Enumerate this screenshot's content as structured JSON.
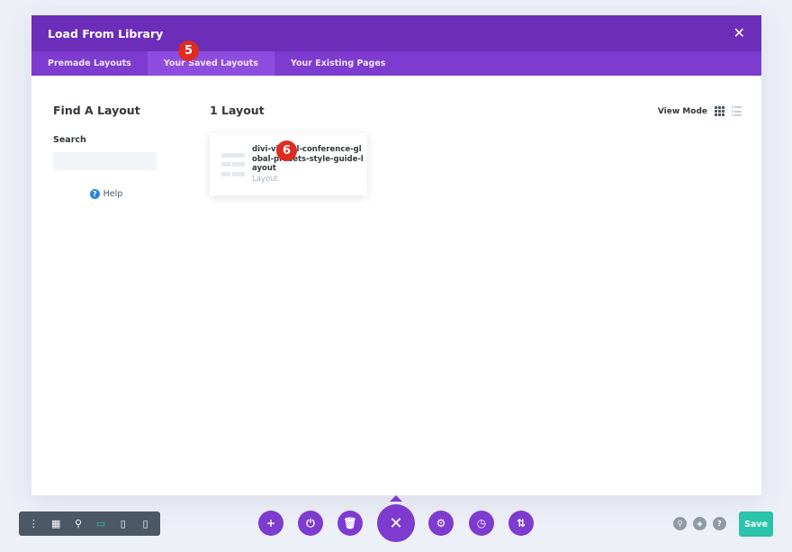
{
  "modal": {
    "title": "Load From Library",
    "close_icon": "close-icon"
  },
  "tabs": [
    {
      "label": "Premade Layouts",
      "active": false
    },
    {
      "label": "Your Saved Layouts",
      "active": true
    },
    {
      "label": "Your Existing Pages",
      "active": false
    }
  ],
  "step_badges": {
    "tabs_step": "5",
    "card_step": "6"
  },
  "sidebar": {
    "heading": "Find A Layout",
    "search_label": "Search",
    "search_placeholder": "",
    "search_value": "",
    "help_label": "Help",
    "help_icon": "help-circle-icon"
  },
  "results": {
    "count_label": "1 Layout",
    "view_mode_label": "View Mode",
    "view_modes": [
      "grid-view-icon",
      "list-view-icon"
    ],
    "active_view": "grid",
    "items": [
      {
        "name": "divi-virtual-conference-global-presets-style-guide-layout",
        "type": "Layout",
        "thumbnail_icon": "layout-thumbnail-icon"
      }
    ]
  },
  "bottom_bar": {
    "device_toolbar_icons": [
      "more-vertical-icon",
      "wireframe-icon",
      "zoom-icon",
      "desktop-icon",
      "tablet-icon",
      "phone-icon"
    ],
    "active_device": "desktop-icon",
    "action_icons": [
      "add-icon",
      "power-icon",
      "trash-icon",
      "close-icon",
      "settings-icon",
      "history-icon",
      "sort-icon"
    ],
    "right_icons": [
      "search-icon",
      "layers-icon",
      "help-icon"
    ],
    "save_label": "Save"
  },
  "colors": {
    "header_purple": "#6c2eb9",
    "tab_purple": "#7d3bd0",
    "active_tab": "#8f4ce0",
    "badge_red": "#e02b20",
    "save_green": "#29c4a9",
    "toolbar_gray": "#4c5866"
  }
}
